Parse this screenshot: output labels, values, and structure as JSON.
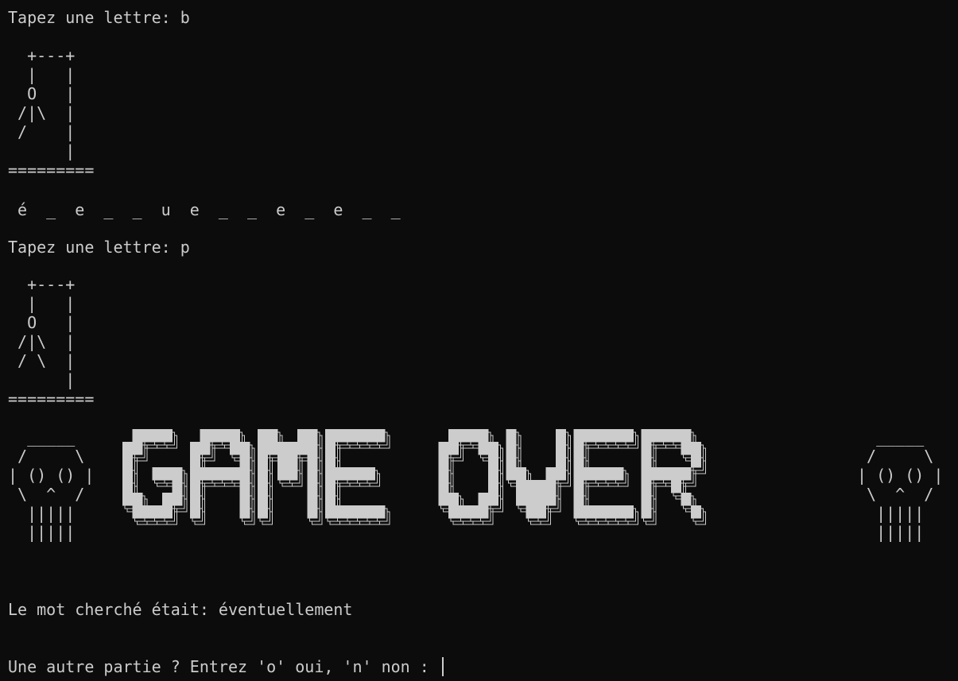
{
  "terminal": {
    "prompt1": "Tapez une lettre: b",
    "gallows1": "  +---+\n  |   |\n  O   |\n /|\\  |\n /    |\n      |\n=========",
    "word_progress": " é  _  e  _  _  u  e  _  _  e  _  e  _  _",
    "prompt2": "Tapez une lettre: p",
    "gallows2": "  +---+\n  |   |\n  O   |\n /|\\  |\n / \\  |\n      |\n=========",
    "skull_left": "  _____\n /     \\\n| () () |\n \\  ^  /\n  |||||\n  |||||",
    "banner_text": "GAME OVER",
    "skull_right": "  _____\n /     \\\n| () () |\n \\  ^  /\n  |||||\n  |||||",
    "answer_line": "Le mot cherché était: éventuellement",
    "replay_prompt": "Une autre partie ? Entrez 'o' oui, 'n' non : "
  }
}
